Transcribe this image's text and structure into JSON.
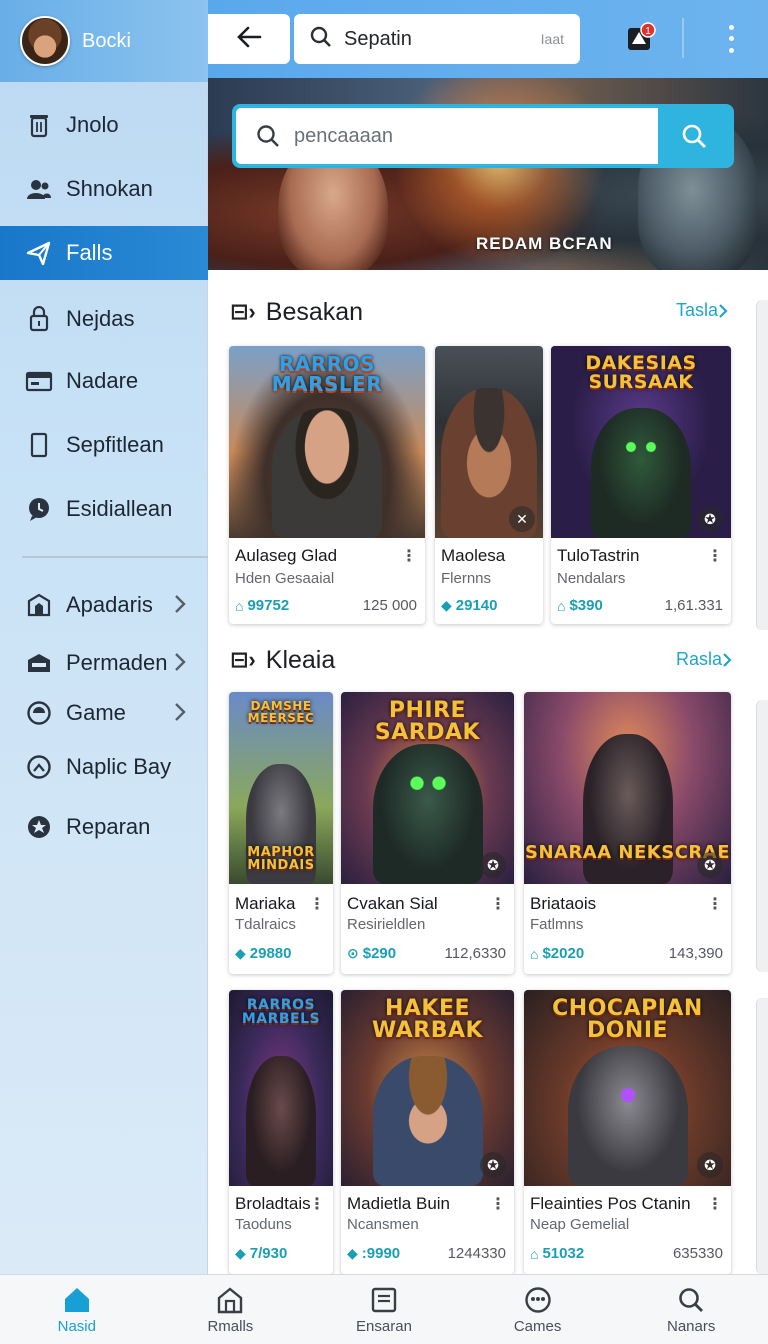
{
  "profile": {
    "name": "Bocki"
  },
  "sidebar": {
    "items": [
      {
        "label": "Jnolo",
        "icon": "trash-can-icon"
      },
      {
        "label": "Shnokan",
        "icon": "users-icon"
      },
      {
        "label": "Falls",
        "icon": "share-icon",
        "active": true
      },
      {
        "label": "Nejdas",
        "icon": "lock-icon"
      },
      {
        "label": "Nadare",
        "icon": "card-icon"
      },
      {
        "label": "Sepfitlean",
        "icon": "tablet-icon"
      },
      {
        "label": "Esidiallean",
        "icon": "chat-bubble-icon"
      }
    ],
    "groups": [
      {
        "label": "Apadaris",
        "icon": "building-icon"
      },
      {
        "label": "Permaden",
        "icon": "store-icon"
      },
      {
        "label": "Game",
        "icon": "circle-icon"
      },
      {
        "label": "Naplic Bay",
        "icon": "clock-icon"
      },
      {
        "label": "Reparan",
        "icon": "badge-icon"
      }
    ]
  },
  "topbar": {
    "search_label": "Sepatin",
    "search_hint": "Iaat",
    "alert_count": "1"
  },
  "hero": {
    "search_placeholder": "pencaaaan",
    "caption": "REDAM BCFAN"
  },
  "sections": [
    {
      "mark": "⊟›",
      "title": "Besakan",
      "see_all": "Tasla",
      "cards": [
        {
          "art_title": "RARROS MARSLER",
          "name": "Aulaseg Glad",
          "sub": "Hden Gesaaial",
          "price": "99752",
          "count": "125 000"
        },
        {
          "art_title": "",
          "name": "Maolesa",
          "sub": "Flernns",
          "price": "29140",
          "count": ""
        },
        {
          "art_title": "DAKESIAS SURSAAK",
          "name": "TuloTastrin",
          "sub": "Nendalars",
          "price": "$390",
          "count": "1,61.331"
        }
      ]
    },
    {
      "mark": "⊟›",
      "title": "Kleaia",
      "see_all": "Rasla",
      "cards": [
        {
          "art_title": "DAMSHE MEERSEC",
          "art_sub": "MAPHOR MINDAIS",
          "name": "Mariaka",
          "sub": "Tdalraics",
          "price": "29880",
          "count": ""
        },
        {
          "art_title": "PHIRE SARDAK",
          "name": "Cvakan Sial",
          "sub": "Resirieldlen",
          "price": "$290",
          "count": "112,6330"
        },
        {
          "art_title": "",
          "art_sub": "SNARAA NEKSCRAE",
          "name": "Briataois",
          "sub": "Fatlmns",
          "price": "$2020",
          "count": "143,390"
        },
        {
          "art_title": "RARROS MARBELS",
          "name": "Broladtais",
          "sub": "Taoduns",
          "price": "7/930",
          "count": ""
        },
        {
          "art_title": "HAKEE WARBAK",
          "name": "Madietla Buin",
          "sub": "Ncansmen",
          "price": ":9990",
          "count": "1244330"
        },
        {
          "art_title": "CHOCAPIAN DONIE",
          "name": "Fleainties Pos Ctanin",
          "sub": "Neap Gemelial",
          "price": "51032",
          "count": "635330"
        }
      ]
    }
  ],
  "bottom_nav": [
    {
      "label": "Nasid",
      "icon": "home-icon",
      "active": true
    },
    {
      "label": "Rmalls",
      "icon": "house-outline-icon"
    },
    {
      "label": "Ensaran",
      "icon": "document-icon"
    },
    {
      "label": "Cames",
      "icon": "gamepad-icon"
    },
    {
      "label": "Nanars",
      "icon": "search-icon"
    }
  ],
  "colors": {
    "accent": "#1fa5c7",
    "active_nav": "#1877c9",
    "topbar": "#5aa8ec"
  }
}
